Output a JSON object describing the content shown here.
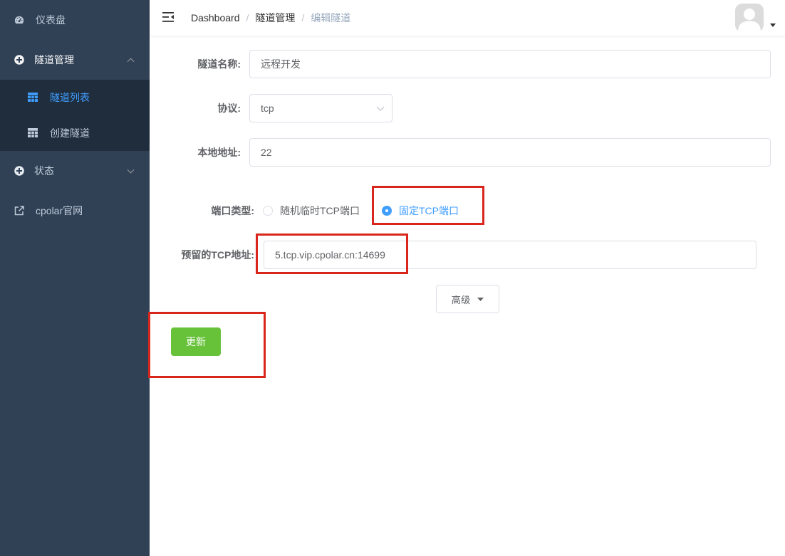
{
  "sidebar": {
    "items": [
      {
        "label": "仪表盘",
        "icon": "dashboard-icon"
      },
      {
        "label": "隧道管理",
        "icon": "tunnel-icon",
        "expanded": true,
        "children": [
          {
            "label": "隧道列表",
            "icon": "table-icon",
            "active": true
          },
          {
            "label": "创建隧道",
            "icon": "table-icon",
            "active": false
          }
        ]
      },
      {
        "label": "状态",
        "icon": "status-icon",
        "expanded": false
      },
      {
        "label": "cpolar官网",
        "icon": "external-link-icon"
      }
    ]
  },
  "navbar": {
    "breadcrumb": [
      "Dashboard",
      "隧道管理",
      "编辑隧道"
    ],
    "separator": "/",
    "hamburger_icon": "menu-fold-icon",
    "avatar_icon": "user-avatar-icon"
  },
  "form": {
    "name": {
      "label": "隧道名称:",
      "value": "远程开发"
    },
    "protocol": {
      "label": "协议:",
      "value": "tcp"
    },
    "local_addr": {
      "label": "本地地址:",
      "value": "22"
    },
    "port_type": {
      "label": "端口类型:",
      "options": [
        {
          "label": "随机临时TCP端口",
          "checked": false
        },
        {
          "label": "固定TCP端口",
          "checked": true
        }
      ]
    },
    "reserved_addr": {
      "label": "预留的TCP地址:",
      "value": "5.tcp.vip.cpolar.cn:14699"
    },
    "advanced_label": "高级",
    "submit_label": "更新"
  },
  "colors": {
    "sidebar_bg": "#304156",
    "submenu_bg": "#1f2d3d",
    "sidebar_text": "#bfcbd9",
    "primary": "#409EFF",
    "success": "#67C23A",
    "annotation": "#d9261c"
  }
}
